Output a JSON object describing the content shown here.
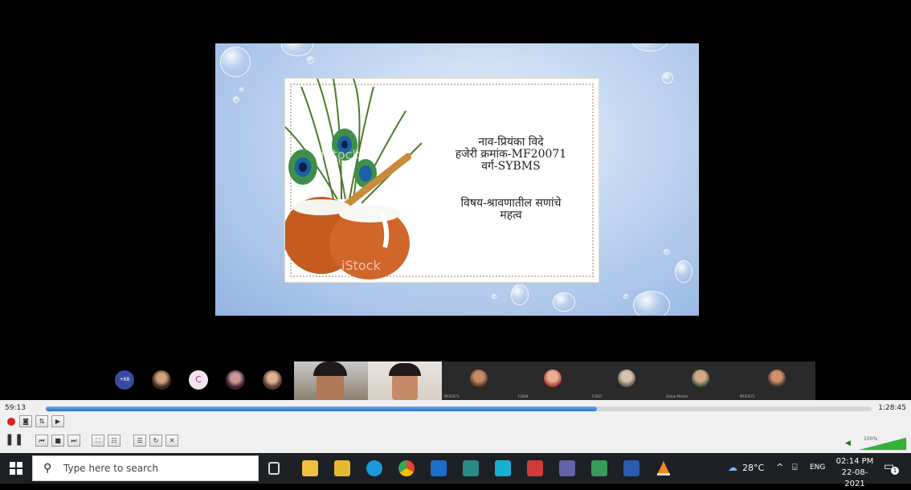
{
  "slide": {
    "line_name": "नाव-प्रियंका विदे",
    "line_roll": "हजेरी क्रमांक-MF20071",
    "line_class": "वर्ग-SYBMS",
    "line_subject": "विषय-श्रावणातील सणांचे",
    "line_subject2": "महत्व",
    "watermark": "iStock"
  },
  "participants": {
    "more_count": "+68",
    "initial_c": "C",
    "tile_labels": [
      "MF20071",
      "F2009",
      "F2007",
      "Shilpa Mhatre",
      "MF20071"
    ]
  },
  "player": {
    "current_time": "59:13",
    "total_time": "1:28:45",
    "progress": 0.667,
    "volume_label": "100%",
    "volume": 1.0
  },
  "taskbar": {
    "search_placeholder": "Type here to search",
    "weather": "28°C",
    "language": "ENG",
    "time": "02:14 PM",
    "date": "22-08-2021",
    "notifications": "1"
  }
}
